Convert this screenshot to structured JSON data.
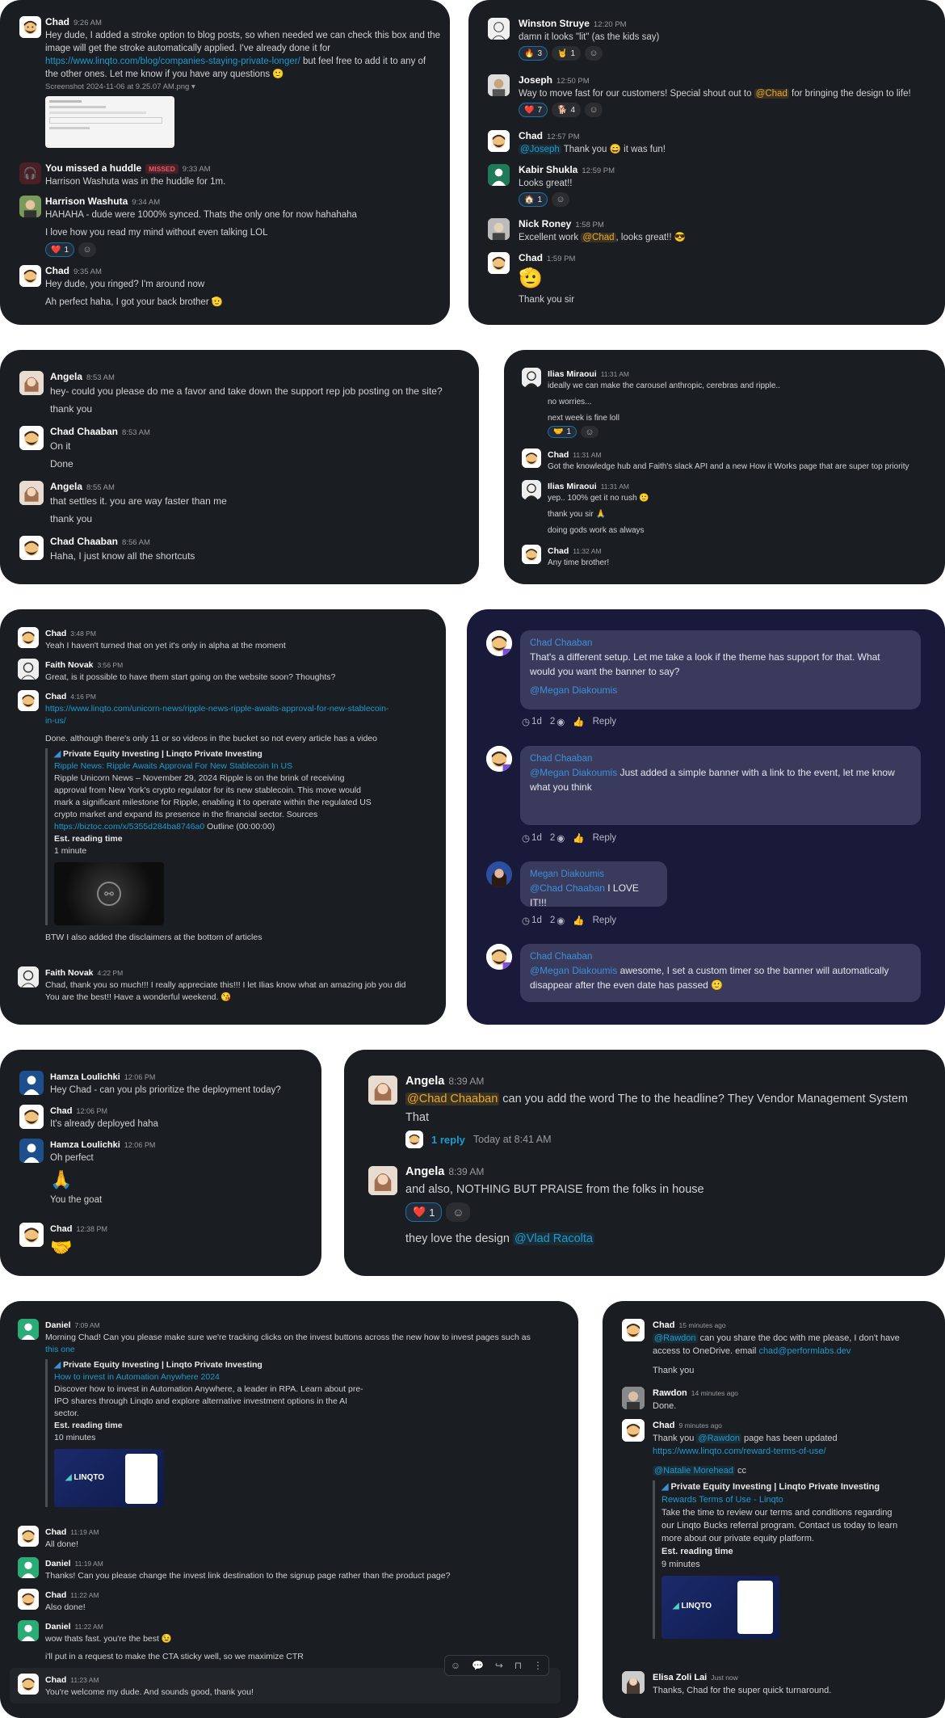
{
  "c1": {
    "m1": {
      "name": "Chad",
      "time": "9:26 AM",
      "t1": "Hey dude, I added a stroke option to blog posts, so when needed we can check this box and the",
      "t2": "image will get the stroke automatically applied. I've already done it for",
      "link": "https://www.linqto.com/blog/companies-staying-private-longer/",
      "t3": " but feel free to add it to any of",
      "t4": "the other ones. Let me know if you have any questions",
      "file": "Screenshot 2024-11-06 at 9.25.07 AM.png"
    },
    "m2": {
      "name": "You missed a huddle",
      "badge": "MISSED",
      "time": "9:33 AM",
      "text": "Harrison Washuta was in the huddle for 1m."
    },
    "m3": {
      "name": "Harrison Washuta",
      "time": "9:34 AM",
      "t1": "HAHAHA - dude were 1000% synced. Thats the only one for now hahahaha",
      "t2": "I love how you read my mind without even talking LOL",
      "rx": "1"
    },
    "m4": {
      "name": "Chad",
      "time": "9:35 AM",
      "t1": "Hey dude, you ringed? I'm around now",
      "t2": "Ah perfect haha, I got your back brother"
    }
  },
  "c2": {
    "m1": {
      "name": "Winston Struye",
      "time": "12:20 PM",
      "text": "damn it looks \"lit\" (as the kids say)",
      "rx1": "3",
      "rx2": "1"
    },
    "m2": {
      "name": "Joseph",
      "time": "12:50 PM",
      "t1": "Way to move fast for our customers! Special shout out to ",
      "mention": "@Chad",
      "t2": " for bringing the design to life!",
      "rx1": "7",
      "rx2": "4"
    },
    "m3": {
      "name": "Chad",
      "time": "12:57 PM",
      "mention": "@Joseph",
      "t1": " Thank you ",
      "t2": " it was fun!"
    },
    "m4": {
      "name": "Kabir Shukla",
      "time": "12:59 PM",
      "text": "Looks great!!",
      "rx": "1"
    },
    "m5": {
      "name": "Nick Roney",
      "time": "1:58 PM",
      "t1": "Excellent work ",
      "mention": "@Chad",
      "t2": ", looks great!!"
    },
    "m6": {
      "name": "Chad",
      "time": "1:59 PM",
      "text": "Thank you sir"
    }
  },
  "c3": {
    "m1": {
      "name": "Angela",
      "time": "8:53 AM",
      "t1": "hey- could you please do me a favor and take down the support rep job posting on the site?",
      "t2": "thank you"
    },
    "m2": {
      "name": "Chad Chaaban",
      "time": "8:53 AM",
      "t1": "On it",
      "t2": "Done"
    },
    "m3": {
      "name": "Angela",
      "time": "8:55 AM",
      "t1": "that settles it. you are way faster than me",
      "t2": "thank you"
    },
    "m4": {
      "name": "Chad Chaaban",
      "time": "8:56 AM",
      "t1": "Haha, I just know all the shortcuts"
    }
  },
  "c4": {
    "m1": {
      "name": "Ilias Miraoui",
      "time": "11:31 AM",
      "t1": "ideally we can make the carousel anthropic, cerebras and ripple..",
      "t2": "no worries...",
      "t3": "next week is fine loll",
      "rx": "1"
    },
    "m2": {
      "name": "Chad",
      "time": "11:31 AM",
      "text": "Got the knowledge hub and Faith's slack API and a new How it Works page that are super top priority"
    },
    "m3": {
      "name": "Ilias Miraoui",
      "time": "11:31 AM",
      "t1": "yep.. 100% get it no rush",
      "t2": "thank you sir",
      "t3": "doing gods work as always"
    },
    "m4": {
      "name": "Chad",
      "time": "11:32 AM",
      "text": "Any time brother!"
    }
  },
  "c5": {
    "m1": {
      "name": "Chad",
      "time": "3:48 PM",
      "text": "Yeah I haven't turned that on yet it's only in alpha at the moment"
    },
    "m2": {
      "name": "Faith Novak",
      "time": "3:56 PM",
      "text": "Great, is it possible to have them start going on the website soon? Thoughts?"
    },
    "m3": {
      "name": "Chad",
      "time": "4:16 PM",
      "link1": "https://www.linqto.com/unicorn-news/ripple-news-ripple-awaits-approval-for-new-stablecoin-",
      "link2": "in-us/",
      "text": "Done. although there's only 11 or so videos in the bucket so not every article has a video",
      "site": "Private Equity Investing | Linqto Private Investing",
      "title": "Ripple News: Ripple Awaits Approval For New Stablecoin In US",
      "d1": "Ripple Unicorn News – November 29, 2024 Ripple is on the brink of receiving",
      "d2": "approval from New York's crypto regulator for its new stablecoin. This move would",
      "d3": "mark a significant milestone for Ripple, enabling it to operate within the regulated US",
      "d4": "crypto market and expand its presence in the financial sector. Sources",
      "src": "https://biztoc.com/x/5355d284ba8746a0",
      "outline": " Outline (00:00:00)",
      "est": "Est. reading time",
      "mins": "1 minute",
      "after": "BTW I also added the disclaimers at the bottom of articles"
    },
    "m4": {
      "name": "Faith Novak",
      "time": "4:22 PM",
      "t1": "Chad, thank you so much!!! I really appreciate this!!! I let Ilias know what an amazing job you did",
      "t2": "You are the best!! Have a wonderful weekend."
    }
  },
  "c6": {
    "b1": {
      "name": "Chad Chaaban",
      "t1": "That's a different setup. Let me take a look if the theme has support for that. What",
      "t2": "would you want the banner to say?",
      "mention": "@Megan Diakoumis",
      "age": "1d",
      "views": "2",
      "reply": "Reply"
    },
    "b2": {
      "name": "Chad Chaaban",
      "mention": "@Megan Diakoumis",
      "t1": " Just added a simple banner with a link to the event, let me know",
      "t2": "what you think",
      "age": "1d",
      "views": "2",
      "reply": "Reply"
    },
    "b3": {
      "name": "Megan Diakoumis",
      "mention": "@Chad Chaaban",
      "t1": " I LOVE IT!!!",
      "age": "1d",
      "views": "2",
      "reply": "Reply"
    },
    "b4": {
      "name": "Chad Chaaban",
      "mention": "@Megan Diakoumis",
      "t1": " awesome, I set a custom timer so the banner will automatically",
      "t2": "disappear after the even date has passed"
    }
  },
  "c7": {
    "m1": {
      "name": "Hamza Loulichki",
      "time": "12:06 PM",
      "text": "Hey Chad - can you pls prioritize the deployment today?"
    },
    "m2": {
      "name": "Chad",
      "time": "12:06 PM",
      "text": "It's already deployed haha"
    },
    "m3": {
      "name": "Hamza Loulichki",
      "time": "12:06 PM",
      "t1": "Oh perfect",
      "t2": "You the goat"
    },
    "m4": {
      "name": "Chad",
      "time": "12:38 PM"
    }
  },
  "c8": {
    "m1": {
      "name": "Angela",
      "time": "8:39 AM",
      "mention": "@Chad Chaaban",
      "t1": " can you add the word The to the headline? They Vendor Management System",
      "t2": "That",
      "reply": "1 reply",
      "reply_time": "Today at 8:41 AM"
    },
    "m2": {
      "name": "Angela",
      "time": "8:39 AM",
      "t1": "and also, NOTHING BUT PRAISE from the folks in house",
      "rx": "1",
      "t2": "they love the design ",
      "mention": "@Vlad Racolta"
    }
  },
  "c9": {
    "m1": {
      "name": "Daniel",
      "time": "7:09 AM",
      "t1": "Morning Chad! Can you please make sure we're tracking clicks on the invest buttons across the new how to invest pages such as",
      "link": "this one",
      "site": "Private Equity Investing | Linqto Private Investing",
      "title": "How to invest in Automation Anywhere 2024",
      "d1": "Discover how to invest in Automation Anywhere, a leader in RPA. Learn about pre-",
      "d2": "IPO shares through Linqto and explore alternative investment options in the AI",
      "d3": "sector.",
      "est": "Est. reading time",
      "mins": "10 minutes",
      "brand": "LINQTO"
    },
    "m2": {
      "name": "Chad",
      "time": "11:19 AM",
      "text": "All done!"
    },
    "m3": {
      "name": "Daniel",
      "time": "11:19 AM",
      "text": "Thanks! Can you please change the invest link destination to the signup page rather than the product page?"
    },
    "m4": {
      "name": "Chad",
      "time": "11:22 AM",
      "text": "Also done!"
    },
    "m5": {
      "name": "Daniel",
      "time": "11:22 AM",
      "t1": "wow thats fast. you're the best",
      "t2": "i'll put in a request to make the CTA sticky well, so we maximize CTR"
    },
    "m6": {
      "name": "Chad",
      "time": "11:23 AM",
      "text": "You're welcome my dude. And sounds good, thank you!"
    }
  },
  "c10": {
    "m1": {
      "name": "Chad",
      "time": "15 minutes ago",
      "mention": "@Rawdon",
      "t1": " can you share the doc with me please, I don't have",
      "t2": "access to OneDrive. email ",
      "email": "chad@performlabs.dev",
      "t3": "Thank you"
    },
    "m2": {
      "name": "Rawdon",
      "time": "14 minutes ago",
      "text": "Done."
    },
    "m3": {
      "name": "Chad",
      "time": "9 minutes ago",
      "t1": "Thank you ",
      "mention": "@Rawdon",
      "t2": " page has been updated",
      "link": "https://www.linqto.com/reward-terms-of-use/",
      "mention2": "@Natalie Morehead",
      "cc": " cc",
      "site": "Private Equity Investing | Linqto Private Investing",
      "title": "Rewards Terms of Use - Linqto",
      "d1": "Take the time to review our terms and conditions regarding",
      "d2": "our Linqto Bucks referral program. Contact us today to learn",
      "d3": "more about our private equity platform.",
      "est": "Est. reading time",
      "mins": "9 minutes",
      "brand": "LINQTO"
    },
    "m4": {
      "name": "Elisa Zoli Lai",
      "time": "Just now",
      "text": "Thanks, Chad for the super quick turnaround."
    }
  }
}
